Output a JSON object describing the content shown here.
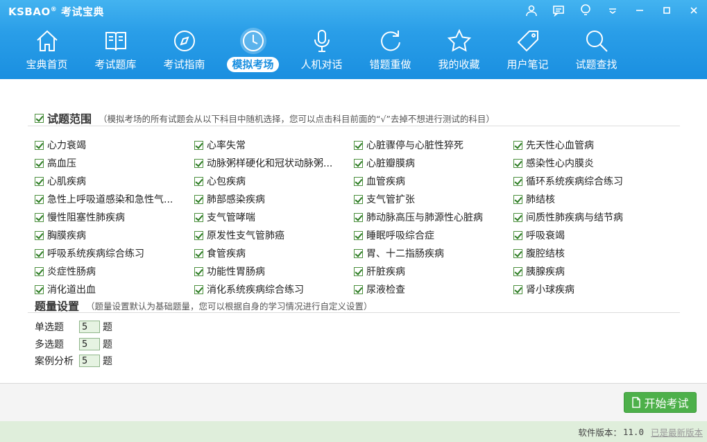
{
  "app": {
    "logo": "KSBAO",
    "logo_mark": "®",
    "logo_cn": "考试宝典"
  },
  "window_controls": [
    "user-icon",
    "message-icon",
    "bulb-icon",
    "dropdown-icon",
    "minimize-icon",
    "maximize-icon",
    "close-icon"
  ],
  "nav": [
    {
      "label": "宝典首页",
      "icon": "home-icon",
      "active": false
    },
    {
      "label": "考试题库",
      "icon": "book-icon",
      "active": false
    },
    {
      "label": "考试指南",
      "icon": "compass-icon",
      "active": false
    },
    {
      "label": "模拟考场",
      "icon": "clock-icon",
      "active": true
    },
    {
      "label": "人机对话",
      "icon": "microphone-icon",
      "active": false
    },
    {
      "label": "错题重做",
      "icon": "refresh-icon",
      "active": false
    },
    {
      "label": "我的收藏",
      "icon": "star-icon",
      "active": false
    },
    {
      "label": "用户笔记",
      "icon": "tag-icon",
      "active": false
    },
    {
      "label": "试题查找",
      "icon": "search-icon",
      "active": false
    }
  ],
  "scope": {
    "title": "试题范围",
    "note": "（模拟考场的所有试题会从以下科目中随机选择，您可以点击科目前面的“√”去掉不想进行测试的科目）",
    "subjects": [
      "心力衰竭",
      "心率失常",
      "心脏骤停与心脏性猝死",
      "先天性心血管病",
      "高血压",
      "动脉粥样硬化和冠状动脉粥...",
      "心脏瓣膜病",
      "感染性心内膜炎",
      "心肌疾病",
      "心包疾病",
      "血管疾病",
      "循环系统疾病综合练习",
      "急性上呼吸道感染和急性气...",
      "肺部感染疾病",
      "支气管扩张",
      "肺结核",
      "慢性阻塞性肺疾病",
      "支气管哮喘",
      "肺动脉高压与肺源性心脏病",
      "间质性肺疾病与结节病",
      "胸膜疾病",
      "原发性支气管肺癌",
      "睡眠呼吸综合症",
      "呼吸衰竭",
      "呼吸系统疾病综合练习",
      "食管疾病",
      "胃、十二指肠疾病",
      "腹腔结核",
      "炎症性肠病",
      "功能性胃肠病",
      "肝脏疾病",
      "胰腺疾病",
      "消化道出血",
      "消化系统疾病综合练习",
      "尿液检查",
      "肾小球疾病"
    ]
  },
  "quantity": {
    "title": "题量设置",
    "note": "（题量设置默认为基础题量，您可以根据自身的学习情况进行自定义设置）",
    "rows": [
      {
        "label": "单选题",
        "value": "5",
        "unit": "题"
      },
      {
        "label": "多选题",
        "value": "5",
        "unit": "题"
      },
      {
        "label": "案例分析",
        "value": "5",
        "unit": "题"
      }
    ]
  },
  "start_button": "开始考试",
  "status": {
    "version_label": "软件版本：",
    "version": "11.0",
    "latest": "已是最新版本"
  },
  "colors": {
    "header": "#1a8fe0",
    "accent_green": "#4db04a",
    "status_bg": "#dfeedb"
  }
}
